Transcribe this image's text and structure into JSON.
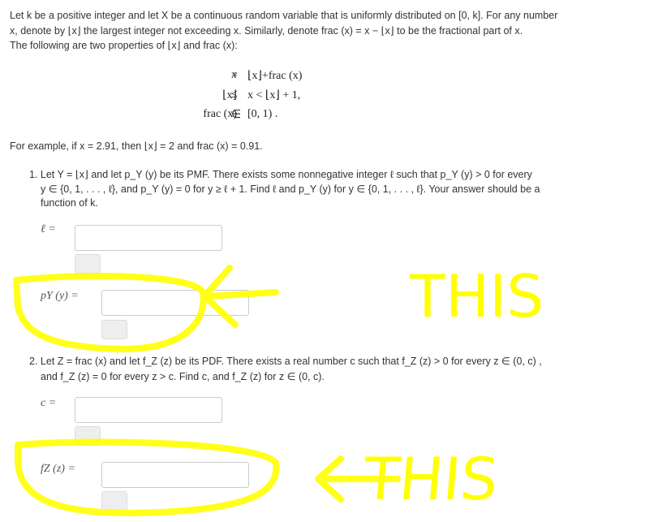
{
  "intro": {
    "line1": "Let k be a positive integer and let X be a continuous random variable that is uniformly distributed on [0, k]. For any number",
    "line2": "x, denote by ⌊x⌋ the largest integer not exceeding x. Similarly, denote frac (x) = x − ⌊x⌋ to be the fractional part of x.",
    "line3": "The following are two properties of ⌊x⌋ and frac (x):"
  },
  "equations": [
    {
      "lhs": "x",
      "rel": "=",
      "rhs": "⌊x⌋+frac (x)"
    },
    {
      "lhs": "⌊x⌋",
      "rel": "≤",
      "rhs": "x < ⌊x⌋ + 1,"
    },
    {
      "lhs": "frac (x)",
      "rel": "∈",
      "rhs": "[0, 1) ."
    }
  ],
  "example": "For example, if x = 2.91, then ⌊x⌋ = 2 and frac (x) = 0.91.",
  "q1": {
    "line1": "1. Let Y = ⌊x⌋ and let p_Y (y) be its PMF. There exists some nonnegative integer ℓ such that p_Y (y) > 0 for every",
    "line2": "y ∈ {0, 1, . . . , ℓ}, and p_Y (y) = 0 for y ≥ ℓ + 1. Find ℓ and p_Y (y) for y ∈ {0, 1, . . . , ℓ}. Your answer should be a",
    "line3": "function of k.",
    "label_l": "ℓ =",
    "label_p": "pY (y) ="
  },
  "q2": {
    "line1": "2. Let Z = frac (x) and let f_Z (z) be its PDF. There exists a real number c such that f_Z (z) > 0 for every z ∈ (0, c) ,",
    "line2": "and f_Z (z) = 0 for every z > c. Find c, and f_Z (z) for z ∈ (0, c).",
    "label_c": "c =",
    "label_f": "fZ (z) ="
  },
  "annotations": {
    "text1": "THIS",
    "text2": "THIS",
    "color": "#ffff00"
  }
}
